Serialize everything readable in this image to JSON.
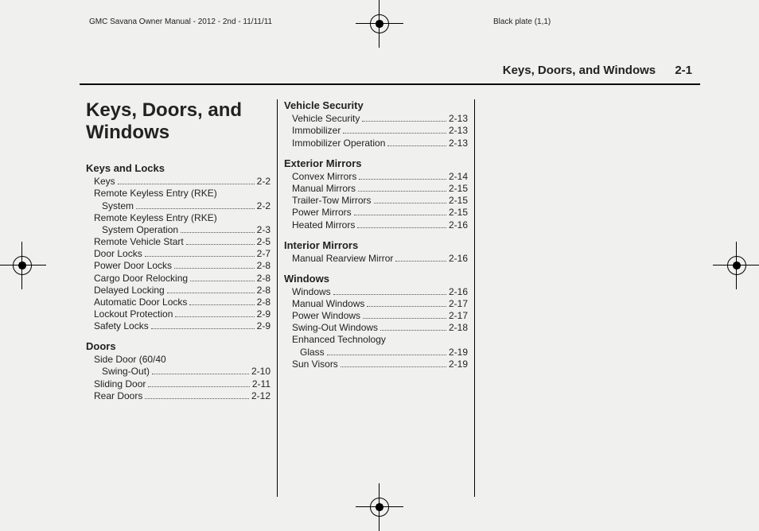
{
  "printer": {
    "doc_id": "GMC Savana Owner Manual - 2012 - 2nd - 11/11/11",
    "plate": "Black plate (1,1)"
  },
  "running_head": {
    "title": "Keys, Doors, and Windows",
    "page": "2-1"
  },
  "chapter_title": "Keys, Doors, and Windows",
  "sections": [
    {
      "name": "Keys and Locks",
      "items": [
        {
          "label": "Keys",
          "page": "2-2"
        },
        {
          "line1": "Remote Keyless Entry (RKE)",
          "line2": "System",
          "page": "2-2"
        },
        {
          "line1": "Remote Keyless Entry (RKE)",
          "line2": "System Operation",
          "page": "2-3"
        },
        {
          "label": "Remote Vehicle Start",
          "page": "2-5"
        },
        {
          "label": "Door Locks",
          "page": "2-7"
        },
        {
          "label": "Power Door Locks",
          "page": "2-8"
        },
        {
          "label": "Cargo Door Relocking",
          "page": "2-8"
        },
        {
          "label": "Delayed Locking",
          "page": "2-8"
        },
        {
          "label": "Automatic Door Locks",
          "page": "2-8"
        },
        {
          "label": "Lockout Protection",
          "page": "2-9"
        },
        {
          "label": "Safety Locks",
          "page": "2-9"
        }
      ]
    },
    {
      "name": "Doors",
      "items": [
        {
          "line1": "Side Door (60/40",
          "line2": "Swing-Out)",
          "page": "2-10"
        },
        {
          "label": "Sliding Door",
          "page": "2-11"
        },
        {
          "label": "Rear Doors",
          "page": "2-12"
        }
      ]
    },
    {
      "name": "Vehicle Security",
      "items": [
        {
          "label": "Vehicle Security",
          "page": "2-13"
        },
        {
          "label": "Immobilizer",
          "page": "2-13"
        },
        {
          "label": "Immobilizer Operation",
          "page": "2-13"
        }
      ]
    },
    {
      "name": "Exterior Mirrors",
      "items": [
        {
          "label": "Convex Mirrors",
          "page": "2-14"
        },
        {
          "label": "Manual Mirrors",
          "page": "2-15"
        },
        {
          "label": "Trailer-Tow Mirrors",
          "page": "2-15"
        },
        {
          "label": "Power Mirrors",
          "page": "2-15"
        },
        {
          "label": "Heated Mirrors",
          "page": "2-16"
        }
      ]
    },
    {
      "name": "Interior Mirrors",
      "items": [
        {
          "label": "Manual Rearview Mirror",
          "page": "2-16"
        }
      ]
    },
    {
      "name": "Windows",
      "items": [
        {
          "label": "Windows",
          "page": "2-16"
        },
        {
          "label": "Manual Windows",
          "page": "2-17"
        },
        {
          "label": "Power Windows",
          "page": "2-17"
        },
        {
          "label": "Swing-Out Windows",
          "page": "2-18"
        },
        {
          "line1": "Enhanced Technology",
          "line2": "Glass",
          "page": "2-19"
        },
        {
          "label": "Sun Visors",
          "page": "2-19"
        }
      ]
    }
  ]
}
